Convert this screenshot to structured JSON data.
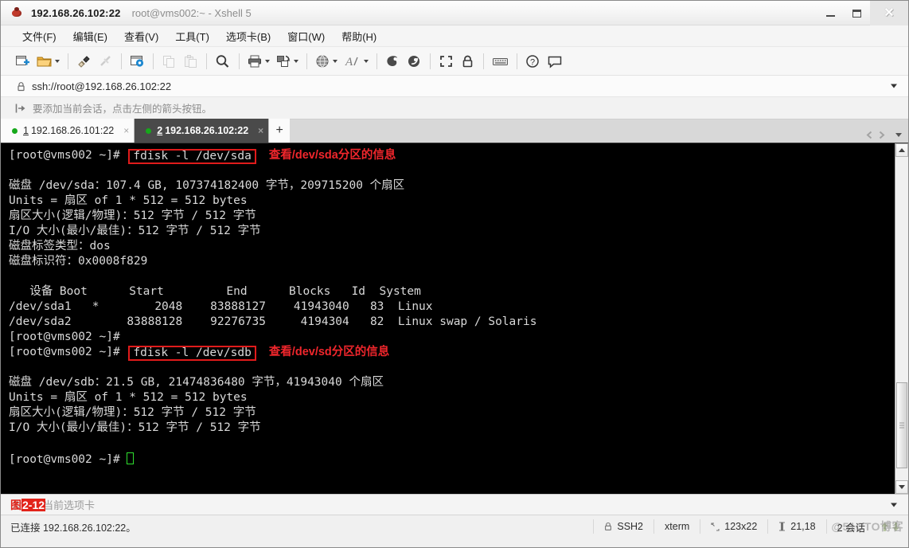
{
  "window": {
    "title_ip": "192.168.26.102:22",
    "title_sub": "root@vms002:~ - Xshell 5",
    "app_icon": "xshell-bug-icon",
    "minimize_label": "Minimize",
    "maximize_label": "Restore",
    "close_label": "✕"
  },
  "menubar": {
    "items": [
      {
        "label": "文件(F)",
        "name": "menu-file"
      },
      {
        "label": "编辑(E)",
        "name": "menu-edit"
      },
      {
        "label": "查看(V)",
        "name": "menu-view"
      },
      {
        "label": "工具(T)",
        "name": "menu-tools"
      },
      {
        "label": "选项卡(B)",
        "name": "menu-tabs"
      },
      {
        "label": "窗口(W)",
        "name": "menu-window"
      },
      {
        "label": "帮助(H)",
        "name": "menu-help"
      }
    ]
  },
  "toolbar": {
    "icons": [
      "new-session-icon",
      "open-folder-icon",
      "connect-icon",
      "disconnect-icon",
      "session-properties-icon",
      "copy-icon",
      "paste-icon",
      "find-icon",
      "print-icon",
      "transfer-icon",
      "globe-icon",
      "font-icon",
      "sftp-icon",
      "ftp-icon",
      "fullscreen-icon",
      "lock-icon",
      "keyboard-icon",
      "help-icon",
      "chat-icon"
    ]
  },
  "address": {
    "lock_icon": "lock-icon",
    "value": "ssh://root@192.168.26.102:22",
    "dropdown_icon": "chevron-down-icon"
  },
  "notice": {
    "icon": "add-session-arrow-icon",
    "text": "要添加当前会话，点击左侧的箭头按钮。"
  },
  "tabs": {
    "items": [
      {
        "num": "1",
        "label": "192.168.26.101:22",
        "active": false,
        "close": "×"
      },
      {
        "num": "2",
        "label": "192.168.26.102:22",
        "active": true,
        "close": "×"
      }
    ],
    "add_label": "+",
    "nav_left_icon": "chevron-left-icon",
    "nav_right_icon": "chevron-right-icon",
    "list_icon": "chevron-down-icon"
  },
  "terminal": {
    "prompt": "[root@vms002 ~]# ",
    "lines": [
      {
        "type": "cmd",
        "prompt": "[root@vms002 ~]# ",
        "command": "fdisk -l /dev/sda",
        "annotation": "查看/dev/sda分区的信息"
      },
      {
        "type": "blank",
        "text": ""
      },
      {
        "type": "out",
        "text": "磁盘 /dev/sda：107.4 GB, 107374182400 字节，209715200 个扇区"
      },
      {
        "type": "out",
        "text": "Units = 扇区 of 1 * 512 = 512 bytes"
      },
      {
        "type": "out",
        "text": "扇区大小(逻辑/物理)：512 字节 / 512 字节"
      },
      {
        "type": "out",
        "text": "I/O 大小(最小/最佳)：512 字节 / 512 字节"
      },
      {
        "type": "out",
        "text": "磁盘标签类型：dos"
      },
      {
        "type": "out",
        "text": "磁盘标识符：0x0008f829"
      },
      {
        "type": "blank",
        "text": ""
      },
      {
        "type": "out",
        "text": "   设备 Boot      Start         End      Blocks   Id  System"
      },
      {
        "type": "out",
        "text": "/dev/sda1   *        2048    83888127    41943040   83  Linux"
      },
      {
        "type": "out",
        "text": "/dev/sda2        83888128    92276735     4194304   82  Linux swap / Solaris"
      },
      {
        "type": "out",
        "text": "[root@vms002 ~]# "
      },
      {
        "type": "cmd",
        "prompt": "[root@vms002 ~]# ",
        "command": "fdisk -l /dev/sdb",
        "annotation": "查看/dev/sd分区的信息"
      },
      {
        "type": "blank",
        "text": ""
      },
      {
        "type": "out",
        "text": "磁盘 /dev/sdb：21.5 GB, 21474836480 字节，41943040 个扇区"
      },
      {
        "type": "out",
        "text": "Units = 扇区 of 1 * 512 = 512 bytes"
      },
      {
        "type": "out",
        "text": "扇区大小(逻辑/物理)：512 字节 / 512 字节"
      },
      {
        "type": "out",
        "text": "I/O 大小(最小/最佳)：512 字节 / 512 字节"
      },
      {
        "type": "blank",
        "text": ""
      },
      {
        "type": "cursor",
        "prompt": "[root@vms002 ~]# "
      }
    ]
  },
  "sendbar": {
    "text": "发送到当前选项卡",
    "figure_prefix": "图",
    "figure_number": "2-12",
    "dropdown_icon": "chevron-down-icon"
  },
  "statusbar": {
    "connection": "已连接 192.168.26.102:22。",
    "protocol": "SSH2",
    "terminal_type": "xterm",
    "size": "123x22",
    "cursor_pos": "21,18",
    "sessions": "2 会话",
    "watermark": "@51CTO博客",
    "protocol_icon": "lock-icon",
    "size_icon": "resize-icon",
    "cursor_icon": "cursor-icon",
    "up_icon": "arrow-up-icon",
    "down_icon": "arrow-down-icon"
  },
  "colors": {
    "accent_red": "#e2231a",
    "terminal_bg": "#000000",
    "terminal_fg": "#d9d9d9",
    "tab_active_bg": "#4a4a4a",
    "dot_green": "#16a81b"
  }
}
